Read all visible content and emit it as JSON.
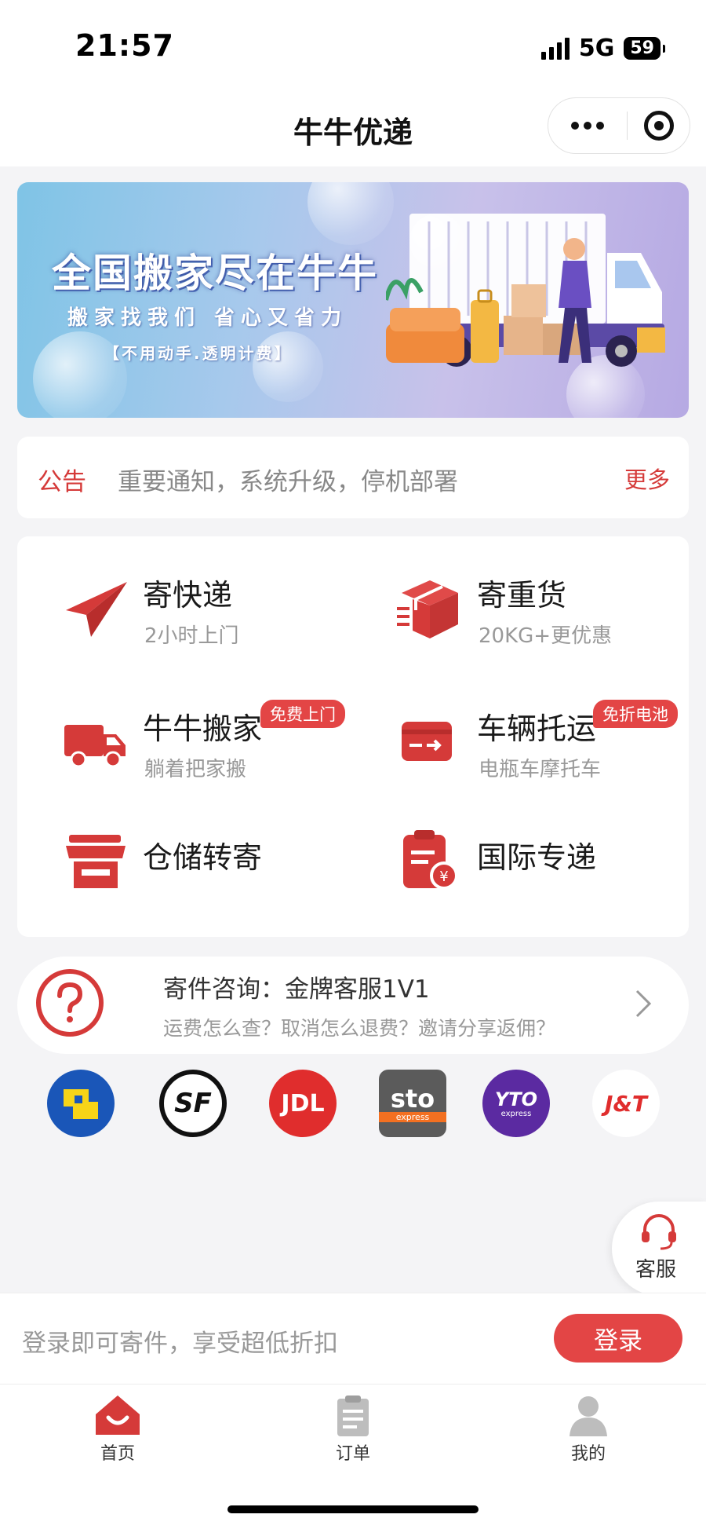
{
  "status_bar": {
    "time": "21:57",
    "network": "5G",
    "battery": "59"
  },
  "nav": {
    "title": "牛牛优递"
  },
  "banner": {
    "headline": "全国搬家尽在牛牛",
    "subline": "搬家找我们 省心又省力",
    "tagline": "【不用动手.透明计费】"
  },
  "notice": {
    "label": "公告",
    "text": "重要通知，系统升级，停机部署",
    "more": "更多"
  },
  "services": [
    {
      "title": "寄快递",
      "subtitle": "2小时上门",
      "icon": "paper-plane-icon"
    },
    {
      "title": "寄重货",
      "subtitle": "20KG+更优惠",
      "icon": "box-icon"
    },
    {
      "title": "牛牛搬家",
      "subtitle": "躺着把家搬",
      "badge": "免费上门",
      "icon": "truck-icon"
    },
    {
      "title": "车辆托运",
      "subtitle": "电瓶车摩托车",
      "badge": "免折电池",
      "icon": "card-icon"
    },
    {
      "title": "仓储转寄",
      "icon": "store-icon"
    },
    {
      "title": "国际专递",
      "icon": "clipboard-yuan-icon"
    }
  ],
  "consult": {
    "title": "寄件咨询：金牌客服1V1",
    "subtitle": "运费怎么查？取消怎么退费？邀请分享返佣？"
  },
  "carriers": [
    "SF",
    "JDL",
    "sto",
    "YTO",
    "J&T"
  ],
  "carrier_sub": {
    "sto": "express",
    "yto": "express"
  },
  "float_service": {
    "label": "客服"
  },
  "login_bar": {
    "hint": "登录即可寄件，享受超低折扣",
    "button": "登录"
  },
  "tabs": [
    {
      "label": "首页",
      "active": true
    },
    {
      "label": "订单",
      "active": false
    },
    {
      "label": "我的",
      "active": false
    }
  ],
  "colors": {
    "accent": "#e34545",
    "accent_text": "#d53a39",
    "background": "#f4f4f6"
  }
}
